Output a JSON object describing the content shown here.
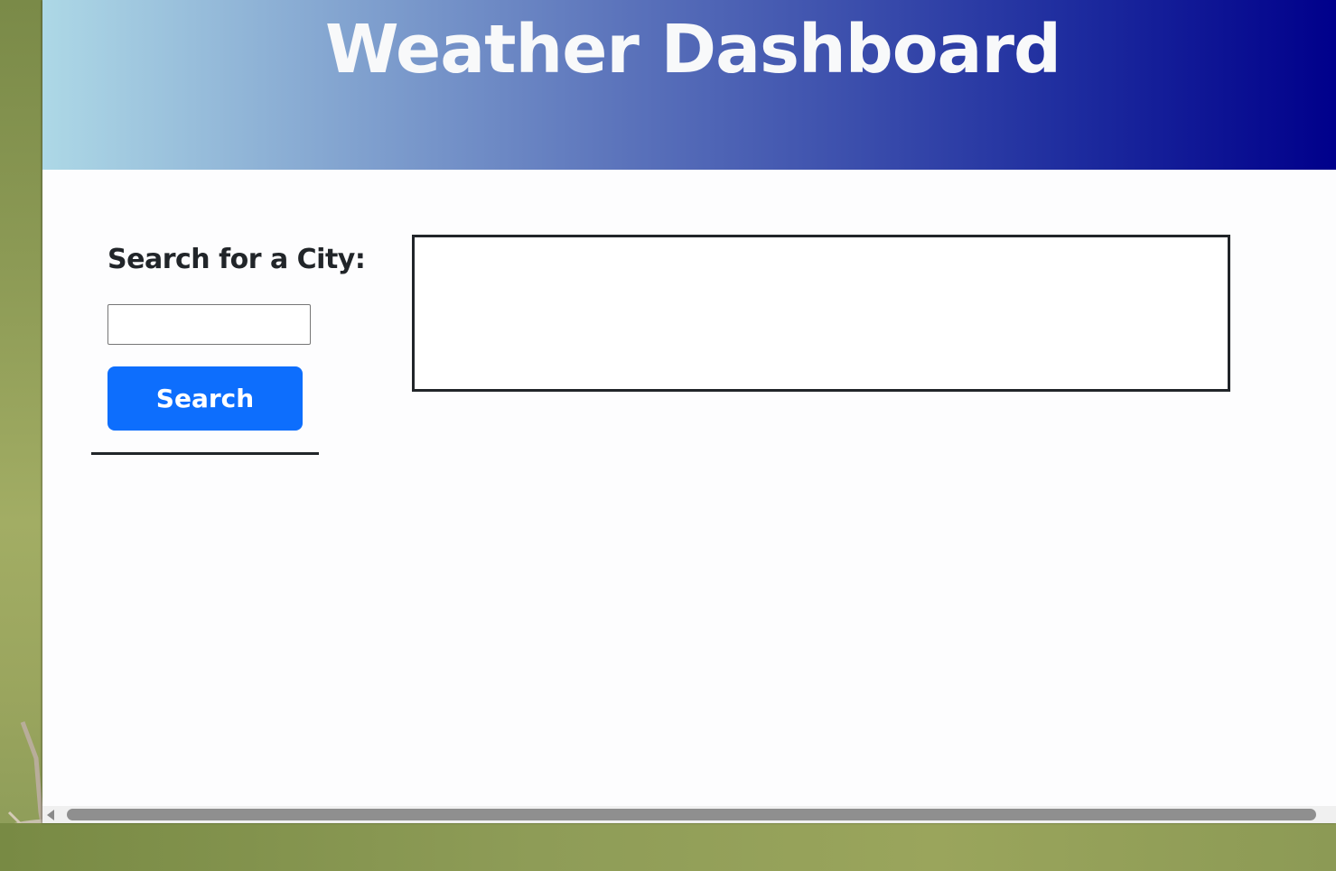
{
  "header": {
    "title": "Weather Dashboard"
  },
  "sidebar": {
    "heading": "Search for a City:",
    "city_input": {
      "value": "",
      "placeholder": ""
    },
    "search_button_label": "Search"
  },
  "current_weather": {
    "content": ""
  },
  "colors": {
    "header_gradient_start": "#add8e6",
    "header_gradient_end": "#00008b",
    "button_primary": "#0d6efd",
    "text_dark": "#212529",
    "title_text": "#f8f9fa"
  },
  "icons": [
    "scroll-left-arrow-icon"
  ]
}
